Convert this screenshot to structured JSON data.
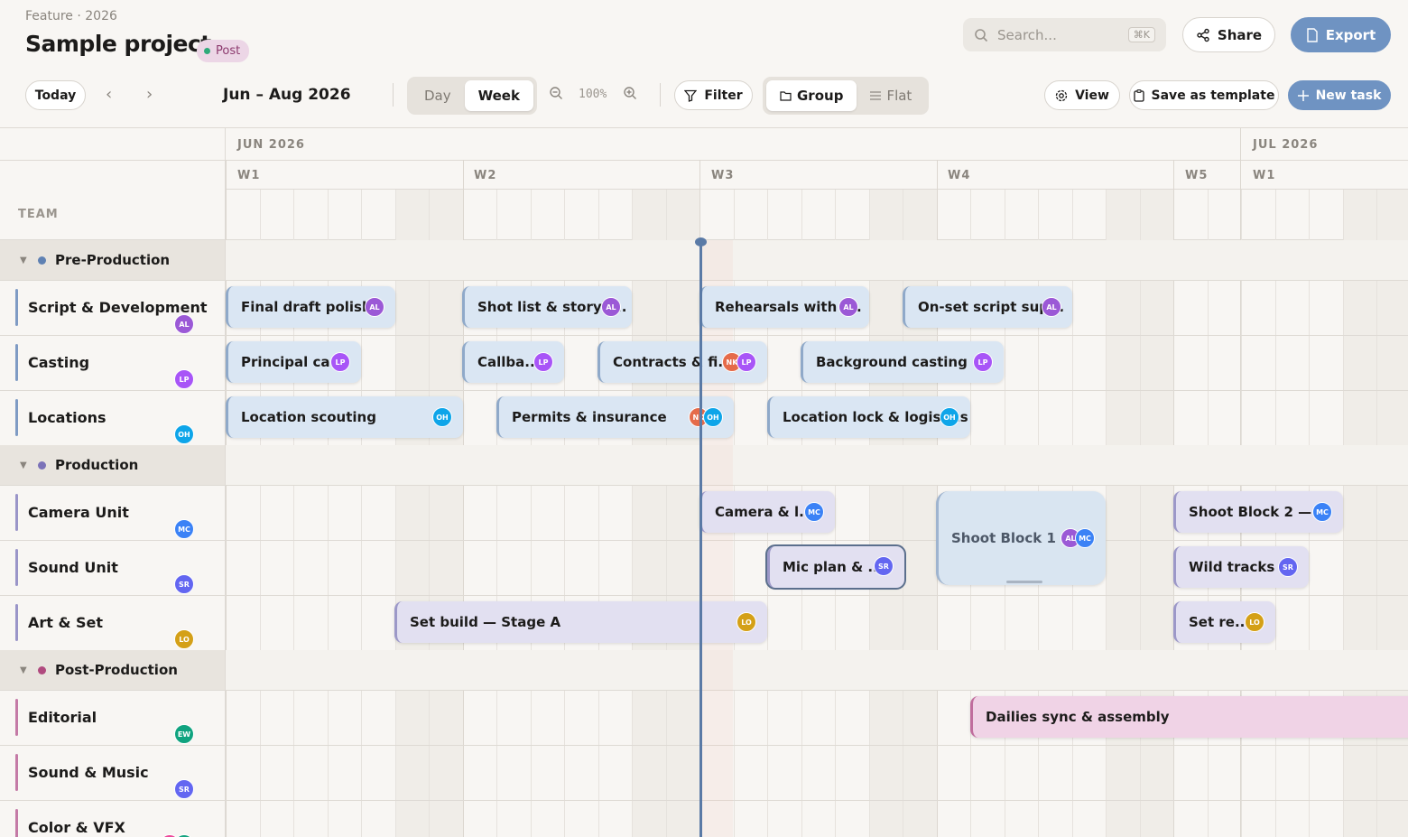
{
  "header": {
    "breadcrumb": "Feature · 2026",
    "title": "Sample project",
    "badge": "Post",
    "search_placeholder": "Search...",
    "search_shortcut": "⌘K",
    "share_label": "Share",
    "export_label": "Export"
  },
  "toolbar": {
    "today_label": "Today",
    "date_range": "Jun – Aug 2026",
    "view_modes": [
      "Day",
      "Week"
    ],
    "active_view_mode": "Week",
    "zoom_level": "100%",
    "filter_label": "Filter",
    "group_modes": [
      "Group",
      "Flat"
    ],
    "active_group_mode": "Group",
    "view_label": "View",
    "save_template_label": "Save as template",
    "new_task_label": "New task"
  },
  "timeline": {
    "months": [
      "JUN 2026",
      "JUL 2026"
    ],
    "weeks": [
      "W1",
      "W2",
      "W3",
      "W4",
      "W5",
      "W1"
    ],
    "team_label": "TEAM"
  },
  "groups": [
    {
      "name": "Pre-Production",
      "color": "#5f81b3",
      "rows": [
        {
          "name": "Script & Development",
          "avatars": [
            {
              "initials": "AL",
              "color": "#9b59d6"
            }
          ],
          "tasks": [
            {
              "name": "Final draft polish",
              "avatars": [
                {
                  "initials": "AL",
                  "color": "#9b59d6"
                }
              ]
            },
            {
              "name": "Shot list & storyb...",
              "avatars": [
                {
                  "initials": "AL",
                  "color": "#9b59d6"
                }
              ]
            },
            {
              "name": "Rehearsals with l...",
              "avatars": [
                {
                  "initials": "AL",
                  "color": "#9b59d6"
                }
              ]
            },
            {
              "name": "On-set script sup...",
              "avatars": [
                {
                  "initials": "AL",
                  "color": "#9b59d6"
                }
              ]
            }
          ]
        },
        {
          "name": "Casting",
          "avatars": [
            {
              "initials": "LP",
              "color": "#a855f7"
            }
          ],
          "tasks": [
            {
              "name": "Principal ca...",
              "avatars": [
                {
                  "initials": "LP",
                  "color": "#a855f7"
                }
              ]
            },
            {
              "name": "Callba...",
              "avatars": [
                {
                  "initials": "LP",
                  "color": "#a855f7"
                }
              ]
            },
            {
              "name": "Contracts & fi...",
              "avatars": [
                {
                  "initials": "NK",
                  "color": "#e56b4a"
                },
                {
                  "initials": "LP",
                  "color": "#a855f7"
                }
              ]
            },
            {
              "name": "Background casting",
              "avatars": [
                {
                  "initials": "LP",
                  "color": "#a855f7"
                }
              ]
            }
          ]
        },
        {
          "name": "Locations",
          "avatars": [
            {
              "initials": "OH",
              "color": "#0ea5e9"
            }
          ],
          "tasks": [
            {
              "name": "Location scouting",
              "avatars": [
                {
                  "initials": "OH",
                  "color": "#0ea5e9"
                }
              ]
            },
            {
              "name": "Permits & insurance",
              "avatars": [
                {
                  "initials": "NK",
                  "color": "#e56b4a"
                },
                {
                  "initials": "OH",
                  "color": "#0ea5e9"
                }
              ]
            },
            {
              "name": "Location lock & logistics",
              "avatars": [
                {
                  "initials": "OH",
                  "color": "#0ea5e9"
                }
              ]
            }
          ]
        }
      ]
    },
    {
      "name": "Production",
      "color": "#7b72b8",
      "rows": [
        {
          "name": "Camera Unit",
          "avatars": [
            {
              "initials": "MC",
              "color": "#3b82f6"
            }
          ],
          "tasks": [
            {
              "name": "Camera & l...",
              "avatars": [
                {
                  "initials": "MC",
                  "color": "#3b82f6"
                }
              ]
            },
            {
              "name": "Shoot Block 1 ...",
              "avatars": [
                {
                  "initials": "AL",
                  "color": "#9b59d6"
                },
                {
                  "initials": "MC",
                  "color": "#3b82f6"
                }
              ]
            },
            {
              "name": "Shoot Block 2 — ...",
              "avatars": [
                {
                  "initials": "MC",
                  "color": "#3b82f6"
                }
              ]
            }
          ]
        },
        {
          "name": "Sound Unit",
          "avatars": [
            {
              "initials": "SR",
              "color": "#6366f1"
            }
          ],
          "tasks": [
            {
              "name": "Mic plan & ...",
              "avatars": [
                {
                  "initials": "SR",
                  "color": "#6366f1"
                }
              ]
            },
            {
              "name": "Wild tracks ...",
              "avatars": [
                {
                  "initials": "SR",
                  "color": "#6366f1"
                }
              ]
            }
          ]
        },
        {
          "name": "Art & Set",
          "avatars": [
            {
              "initials": "LO",
              "color": "#d4a017"
            }
          ],
          "tasks": [
            {
              "name": "Set build — Stage A",
              "avatars": [
                {
                  "initials": "LO",
                  "color": "#d4a017"
                }
              ]
            },
            {
              "name": "Set re...",
              "avatars": [
                {
                  "initials": "LO",
                  "color": "#d4a017"
                }
              ]
            }
          ]
        }
      ]
    },
    {
      "name": "Post-Production",
      "color": "#b04a7f",
      "rows": [
        {
          "name": "Editorial",
          "avatars": [
            {
              "initials": "EW",
              "color": "#10a37f"
            }
          ],
          "tasks": [
            {
              "name": "Dailies sync & assembly",
              "avatars": []
            }
          ]
        },
        {
          "name": "Sound & Music",
          "avatars": [
            {
              "initials": "SR",
              "color": "#6366f1"
            }
          ],
          "tasks": []
        },
        {
          "name": "Color & VFX",
          "avatars": [
            {
              "initials": "ZD",
              "color": "#ec4899"
            },
            {
              "initials": "MB",
              "color": "#14a37f"
            }
          ],
          "tasks": []
        }
      ]
    }
  ]
}
